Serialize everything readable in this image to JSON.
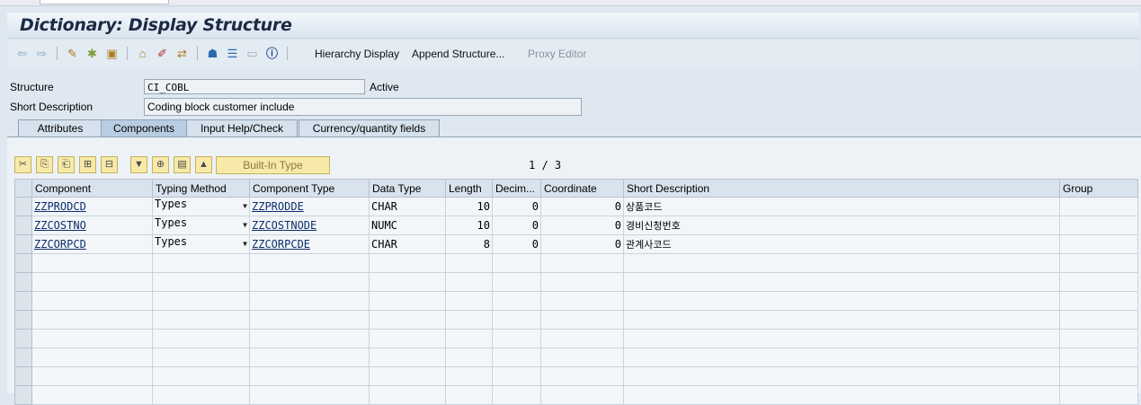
{
  "window": {
    "title": "Dictionary: Display Structure"
  },
  "toolbar": {
    "hierarchy_display": "Hierarchy Display",
    "append_structure": "Append Structure...",
    "proxy_editor": "Proxy Editor"
  },
  "header": {
    "structure_label": "Structure",
    "structure_value": "CI_COBL",
    "status": "Active",
    "short_desc_label": "Short Description",
    "short_desc_value": "Coding block customer include"
  },
  "tabs": [
    {
      "label": "Attributes",
      "active": false
    },
    {
      "label": "Components",
      "active": true
    },
    {
      "label": "Input Help/Check",
      "active": false
    },
    {
      "label": "Currency/quantity fields",
      "active": false
    }
  ],
  "grid_toolbar": {
    "builtin_type": "Built-In Type",
    "page_indicator": "1 / 3"
  },
  "table": {
    "columns": [
      "Component",
      "Typing Method",
      "Component Type",
      "Data Type",
      "Length",
      "Decim...",
      "Coordinate",
      "Short Description",
      "Group"
    ],
    "rows": [
      {
        "component": "ZZPRODCD",
        "typing": "Types",
        "comp_type": "ZZPRODDE",
        "data_type": "CHAR",
        "length": "10",
        "decimals": "0",
        "coordinate": "0",
        "short_desc": "상품코드",
        "group": ""
      },
      {
        "component": "ZZCOSTNO",
        "typing": "Types",
        "comp_type": "ZZCOSTNODE",
        "data_type": "NUMC",
        "length": "10",
        "decimals": "0",
        "coordinate": "0",
        "short_desc": "경비신청번호",
        "group": ""
      },
      {
        "component": "ZZCORPCD",
        "typing": "Types",
        "comp_type": "ZZCORPCDE",
        "data_type": "CHAR",
        "length": "8",
        "decimals": "0",
        "coordinate": "0",
        "short_desc": "관계사코드",
        "group": ""
      }
    ]
  },
  "colors": {
    "title_bg": "#d9e4ef",
    "builtin_btn": "#f7e9a8",
    "tab_active": "#b9cde2"
  }
}
